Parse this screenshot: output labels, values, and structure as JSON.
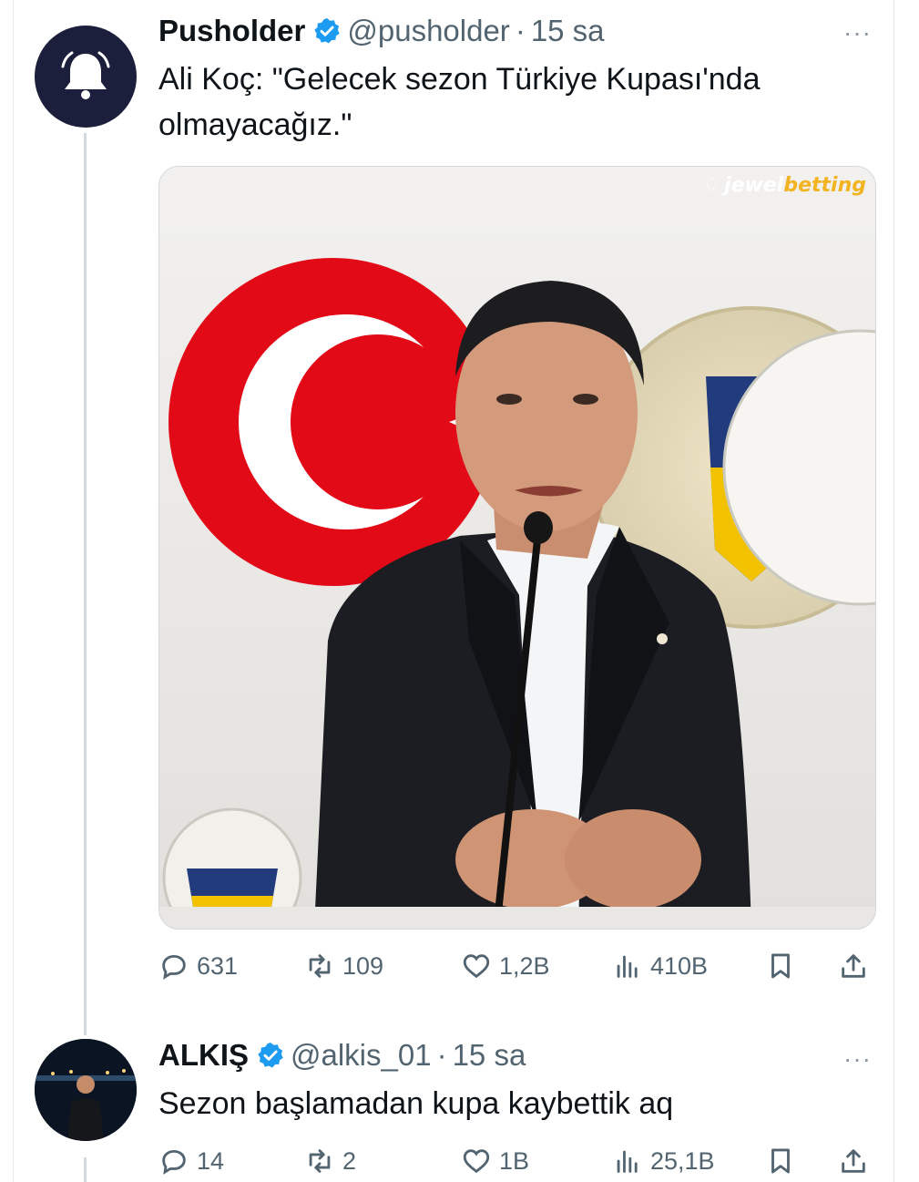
{
  "tweet": {
    "author_name": "Pusholder",
    "handle": "@pusholder",
    "separator": "·",
    "time": "15 sa",
    "more": "···",
    "text_line1": "Ali Koç: \"Gelecek sezon Türkiye Kupası'nda",
    "text_line2": "olmayacağız.\"",
    "media_watermark_1": "jewel",
    "media_watermark_2": "betting",
    "replies": "631",
    "retweets": "109",
    "likes": "1,2B",
    "views": "410B"
  },
  "reply": {
    "author_name": "ALKIŞ",
    "handle": "@alkis_01",
    "separator": "·",
    "time": "15 sa",
    "more": "···",
    "text": "Sezon başlamadan kupa kaybettik aq",
    "replies": "14",
    "retweets": "2",
    "likes": "1B",
    "views": "25,1B"
  },
  "colors": {
    "verified": "#1d9bf0",
    "muted": "#536471",
    "accent_turkish_red": "#e30a17"
  },
  "icons": [
    "bell-icon",
    "verified-icon",
    "reply-icon",
    "retweet-icon",
    "like-icon",
    "views-icon",
    "bookmark-icon",
    "share-icon"
  ]
}
